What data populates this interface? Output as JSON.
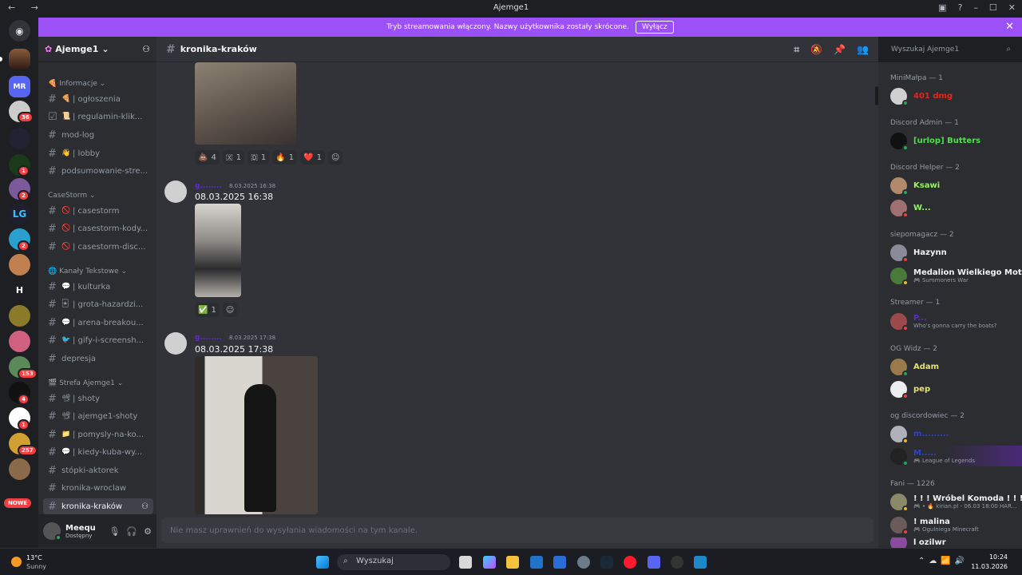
{
  "window": {
    "title": "Ajemge1",
    "nav": "← →"
  },
  "banner": {
    "text": "Tryb streamowania włączony. Nazwy użytkownika zostały skrócone.",
    "button": "Wyłącz",
    "close": "✕"
  },
  "rail": {
    "badges": [
      "36",
      "1",
      "2",
      "2",
      "153",
      "4",
      "1",
      "257"
    ],
    "h_label": "H",
    "new_label": "NOWE",
    "discord_icon": "discord-icon"
  },
  "server": {
    "name": "Ajemge1"
  },
  "categories": [
    {
      "label": "Informacje"
    },
    {
      "label": "CaseStorm"
    },
    {
      "label": "Kanały Tekstowe"
    },
    {
      "label": "Strefa Ajemge1"
    }
  ],
  "channels": [
    {
      "emoji": "🍕",
      "name": "| ogłoszenia"
    },
    {
      "emoji": "📜",
      "name": "| regulamin-klik..."
    },
    {
      "emoji": "",
      "name": "mod-log"
    },
    {
      "emoji": "👋",
      "name": "| lobby"
    },
    {
      "emoji": "",
      "name": "podsumowanie-stre..."
    },
    {
      "emoji": "🚫",
      "name": "| casestorm"
    },
    {
      "emoji": "🚫",
      "name": "| casestorm-kody..."
    },
    {
      "emoji": "🚫",
      "name": "| casestorm-disc..."
    },
    {
      "emoji": "💬",
      "name": "| kulturka"
    },
    {
      "emoji": "🃏",
      "name": "| grota-hazardzi..."
    },
    {
      "emoji": "💬",
      "name": "| arena-breakou..."
    },
    {
      "emoji": "🐦",
      "name": "| gify-i-screensh..."
    },
    {
      "emoji": "",
      "name": "depresja"
    },
    {
      "emoji": "📽",
      "name": "| shoty"
    },
    {
      "emoji": "📽",
      "name": "| ajemge1-shoty"
    },
    {
      "emoji": "📁",
      "name": "| pomysly-na-ko..."
    },
    {
      "emoji": "💬",
      "name": "| kiedy-kuba-wy..."
    },
    {
      "emoji": "",
      "name": "stópki-aktorek"
    },
    {
      "emoji": "",
      "name": "kronika-wroclaw"
    },
    {
      "emoji": "",
      "name": "kronika-kraków"
    }
  ],
  "user": {
    "name": "Meequ",
    "status": "Dostępny"
  },
  "main": {
    "channel": "kronika-kraków",
    "composer_placeholder": "Nie masz uprawnień do wysyłania wiadomości na tym kanale."
  },
  "reactions1": [
    {
      "emoji": "💩",
      "count": "4"
    },
    {
      "emoji": "🇽",
      "count": "1"
    },
    {
      "emoji": "🇩",
      "count": "1"
    },
    {
      "emoji": "🔥",
      "count": "1"
    },
    {
      "emoji": "❤️",
      "count": "1"
    }
  ],
  "messages": [
    {
      "author": "g........",
      "time": "8.03.2025 16:38",
      "text": "08.03.2025 16:38",
      "reactions": [
        {
          "emoji": "✅",
          "count": "1"
        }
      ]
    },
    {
      "author": "g........",
      "time": "8.03.2025 17:38",
      "text": "08.03.2025 17:38"
    }
  ],
  "members": {
    "search_placeholder": "Wyszukaj Ajemge1",
    "groups": [
      {
        "title": "MiniMałpa — 1",
        "members": [
          {
            "name": "401 dmg",
            "color": "#e3261c",
            "sub": ""
          }
        ]
      },
      {
        "title": "Discord Admin — 1",
        "members": [
          {
            "name": "[urlop] Butters",
            "color": "#4fe04f",
            "sub": ""
          }
        ]
      },
      {
        "title": "Discord Helper — 2",
        "members": [
          {
            "name": "Ksawi",
            "color": "#9bf06b",
            "sub": ""
          },
          {
            "name": "W...",
            "color": "#9bf06b",
            "sub": ""
          }
        ]
      },
      {
        "title": "siepomagacz — 2",
        "members": [
          {
            "name": "Hazynn",
            "color": "#f2f3f5",
            "sub": ""
          },
          {
            "name": "Medalion Wielkiego Motyla",
            "color": "#f2f3f5",
            "sub": "🎮 Summoners War"
          }
        ]
      },
      {
        "title": "Streamer — 1",
        "members": [
          {
            "name": "P...",
            "color": "#5d2ccc",
            "sub": "Who's gonna carry the boats?"
          }
        ]
      },
      {
        "title": "OG Widz — 2",
        "members": [
          {
            "name": "Adam",
            "color": "#e6e36b",
            "sub": ""
          },
          {
            "name": "pep",
            "color": "#e6e36b",
            "sub": ""
          }
        ]
      },
      {
        "title": "og discordowiec — 2",
        "members": [
          {
            "name": "m.........",
            "color": "#2f3fe0",
            "sub": ""
          },
          {
            "name": "M.....",
            "color": "#2f3fe0",
            "sub": "🎮 League of Legends"
          }
        ]
      },
      {
        "title": "Fani — 1226",
        "members": [
          {
            "name": "! ! ! Wróbel Komoda ! ! !",
            "color": "#f2f3f5",
            "sub": "🎮 • 🔥 kirian.pl - 06.03 18:00 HAR..."
          },
          {
            "name": "! malina",
            "color": "#f2f3f5",
            "sub": "🎮 Ogulniega Minecraft"
          },
          {
            "name": "l ozilwr",
            "color": "#f2f3f5",
            "sub": ""
          }
        ]
      }
    ]
  },
  "taskbar": {
    "weather_temp": "13°C",
    "weather_desc": "Sunny",
    "search": "Wyszukaj",
    "time": "10:24",
    "date": "11.03.2026"
  }
}
